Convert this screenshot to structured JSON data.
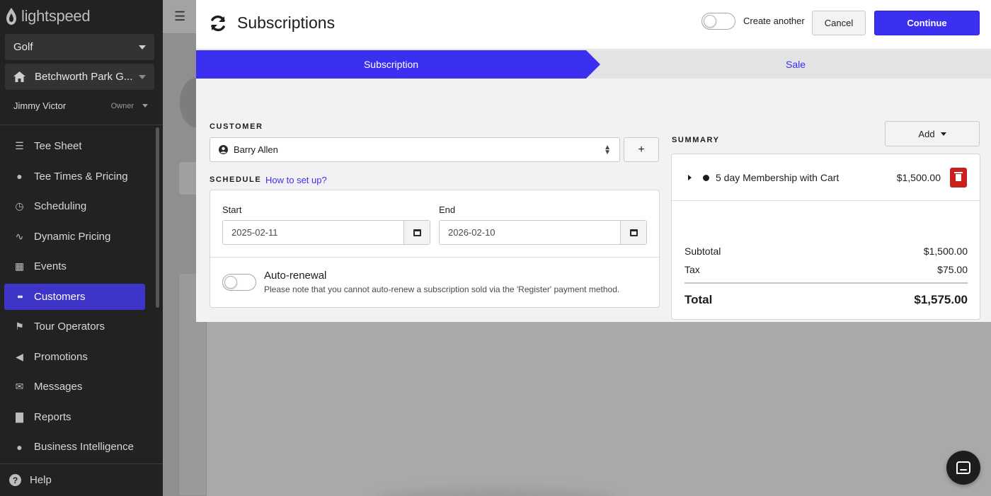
{
  "sidebar": {
    "logo_text": "lightspeed",
    "category_select": "Golf",
    "location_select": "Betchworth Park G...",
    "user_name": "Jimmy Victor",
    "user_role": "Owner",
    "items": [
      {
        "label": "Tee Sheet",
        "icon": "grid-list-icon"
      },
      {
        "label": "Tee Times & Pricing",
        "icon": "golf-tee-icon"
      },
      {
        "label": "Scheduling",
        "icon": "clock-icon"
      },
      {
        "label": "Dynamic Pricing",
        "icon": "pulse-icon"
      },
      {
        "label": "Events",
        "icon": "calendar-icon"
      },
      {
        "label": "Customers",
        "icon": "users-icon",
        "active": true
      },
      {
        "label": "Tour Operators",
        "icon": "golf-flag-icon"
      },
      {
        "label": "Promotions",
        "icon": "megaphone-icon"
      },
      {
        "label": "Messages",
        "icon": "envelope-icon"
      },
      {
        "label": "Reports",
        "icon": "bar-chart-icon"
      },
      {
        "label": "Business Intelligence",
        "icon": "lightbulb-icon"
      }
    ],
    "help_label": "Help"
  },
  "modal": {
    "title": "Subscriptions",
    "create_another_label": "Create another",
    "cancel_label": "Cancel",
    "continue_label": "Continue",
    "steps": [
      {
        "label": "Subscription",
        "active": true
      },
      {
        "label": "Sale",
        "active": false
      }
    ],
    "customer": {
      "section_label": "CUSTOMER",
      "selected": "Barry Allen",
      "add_label": "+"
    },
    "schedule": {
      "section_label": "SCHEDULE",
      "help_link": "How to set up?",
      "start_label": "Start",
      "start_value": "2025-02-11",
      "end_label": "End",
      "end_value": "2026-02-10",
      "auto_renewal_title": "Auto-renewal",
      "auto_renewal_note": "Please note that you cannot auto-renew a subscription sold via the 'Register' payment method."
    },
    "summary": {
      "section_label": "SUMMARY",
      "add_label": "Add",
      "item_name": "5 day Membership with Cart",
      "item_price": "$1,500.00",
      "subtotal_label": "Subtotal",
      "subtotal_value": "$1,500.00",
      "tax_label": "Tax",
      "tax_value": "$75.00",
      "total_label": "Total",
      "total_value": "$1,575.00"
    }
  },
  "colors": {
    "accent": "#3b2ff0",
    "sidebar_bg": "#222224",
    "sidebar_active": "#3c35c8",
    "danger": "#c8201f"
  }
}
